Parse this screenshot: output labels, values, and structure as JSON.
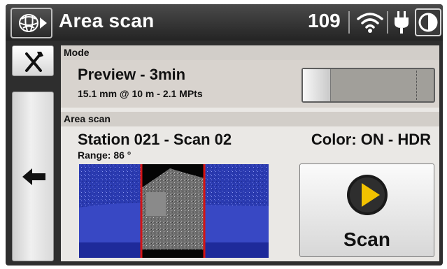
{
  "titlebar": {
    "title": "Area scan",
    "battery_value": "109",
    "icons": [
      "app-logo-icon",
      "wifi-icon",
      "power-plug-icon",
      "contrast-icon"
    ]
  },
  "sidebar": {
    "tools_icon": "tools-icon",
    "back_icon": "back-arrow-icon"
  },
  "mode": {
    "header": "Mode",
    "name": "Preview - 3min",
    "detail": "15.1 mm @ 10 m - 2.1 MPts",
    "slider_level": 0
  },
  "area_scan": {
    "header": "Area scan",
    "station": "Station 021 - Scan 02",
    "color_status": "Color: ON - HDR",
    "range": "Range: 86 °"
  },
  "scan_button": {
    "label": "Scan",
    "icon": "play-icon"
  },
  "colors": {
    "accent_yellow": "#f2c200",
    "preview_blue": "#2a3ab0",
    "selection_red": "#d41414",
    "panel_bg": "#eae8e5",
    "section_header": "#d2cec9"
  }
}
